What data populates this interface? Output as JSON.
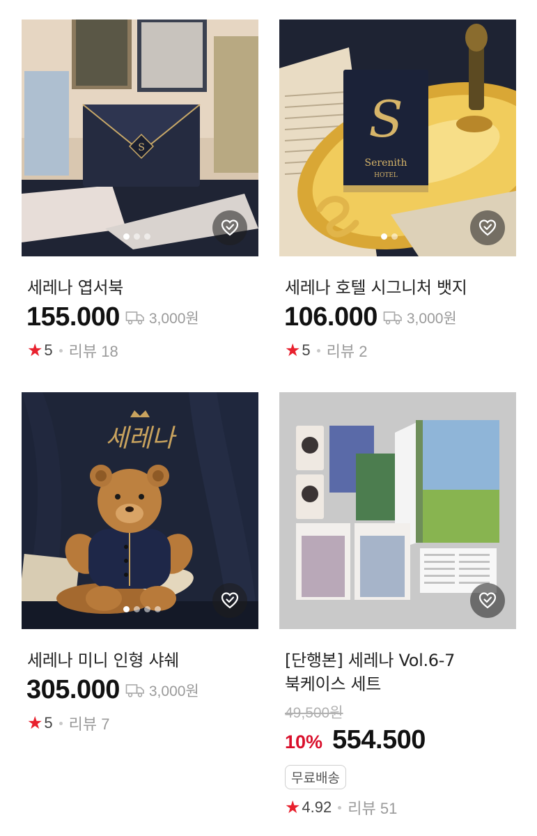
{
  "products": [
    {
      "title": "세레나 엽서북",
      "price": "155.000",
      "shipping": "3,000원",
      "rating": "5",
      "reviews": "리뷰 18",
      "icons": {
        "wishlist": "heart-check-icon",
        "shipping": "truck-icon",
        "rating": "star-icon"
      }
    },
    {
      "title": "세레나 호텔 시그니처 뱃지",
      "price": "106.000",
      "shipping": "3,000원",
      "rating": "5",
      "reviews": "리뷰 2"
    },
    {
      "title": "세레나 미니 인형 샤쉐",
      "price": "305.000",
      "shipping": "3,000원",
      "rating": "5",
      "reviews": "리뷰 7"
    },
    {
      "title_line1": "[단행본] 세레나 Vol.6-7",
      "title_line2": "북케이스 세트",
      "original_price": "49,500원",
      "discount": "10%",
      "price": "554.500",
      "badge": "무료배송",
      "rating": "4.92",
      "reviews": "리뷰 51"
    }
  ],
  "images": {
    "p1_emblem": "S",
    "p2_card_letter": "S",
    "p2_card_text1": "Serenith",
    "p2_card_text2": "HOTEL",
    "p3_logo": "세레나"
  },
  "carousel": {
    "p1_slides": 3,
    "p1_active": 1,
    "p2_slides": 2,
    "p2_active": 1,
    "p3_slides": 4,
    "p3_active": 1
  },
  "colors": {
    "star": "#e8212e",
    "discount": "#d90f2b",
    "price": "#111111",
    "muted": "#9a9a9a"
  }
}
